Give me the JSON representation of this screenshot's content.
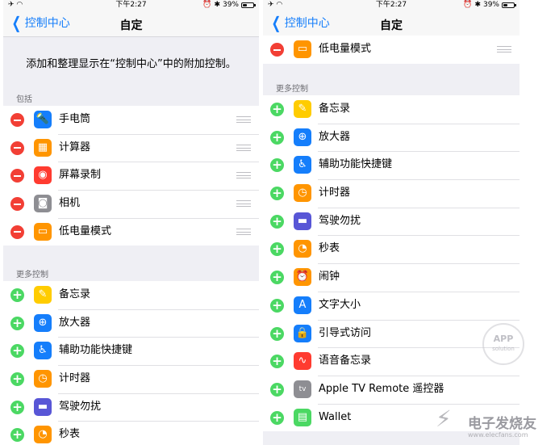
{
  "left": {
    "status": {
      "time": "下午2:27",
      "battery": "39%",
      "battery_level": 0.39
    },
    "nav": {
      "back": "控制中心",
      "title": "自定"
    },
    "description": "添加和整理显示在“控制中心”中的附加控制。",
    "included_header": "包括",
    "included": [
      {
        "label": "手电筒",
        "icon": "flashlight-icon",
        "color": "#157efb"
      },
      {
        "label": "计算器",
        "icon": "calculator-icon",
        "color": "#ff9500"
      },
      {
        "label": "屏幕录制",
        "icon": "screen-record-icon",
        "color": "#ff3b30"
      },
      {
        "label": "相机",
        "icon": "camera-icon",
        "color": "#8e8e93"
      },
      {
        "label": "低电量模式",
        "icon": "low-power-icon",
        "color": "#ff9500"
      }
    ],
    "more_header": "更多控制",
    "more": [
      {
        "label": "备忘录",
        "icon": "notes-icon",
        "color": "#ffcc00"
      },
      {
        "label": "放大器",
        "icon": "magnifier-icon",
        "color": "#157efb"
      },
      {
        "label": "辅助功能快捷键",
        "icon": "accessibility-icon",
        "color": "#157efb"
      },
      {
        "label": "计时器",
        "icon": "timer-icon",
        "color": "#ff9500"
      },
      {
        "label": "驾驶勿扰",
        "icon": "car-icon",
        "color": "#5856d6"
      },
      {
        "label": "秒表",
        "icon": "stopwatch-icon",
        "color": "#ff9500"
      }
    ]
  },
  "right": {
    "status": {
      "time": "下午2:27",
      "battery": "39%",
      "battery_level": 0.39
    },
    "nav": {
      "back": "控制中心",
      "title": "自定"
    },
    "included": [
      {
        "label": "低电量模式",
        "icon": "low-power-icon",
        "color": "#ff9500"
      }
    ],
    "more_header": "更多控制",
    "more": [
      {
        "label": "备忘录",
        "icon": "notes-icon",
        "color": "#ffcc00"
      },
      {
        "label": "放大器",
        "icon": "magnifier-icon",
        "color": "#157efb"
      },
      {
        "label": "辅助功能快捷键",
        "icon": "accessibility-icon",
        "color": "#157efb"
      },
      {
        "label": "计时器",
        "icon": "timer-icon",
        "color": "#ff9500"
      },
      {
        "label": "驾驶勿扰",
        "icon": "car-icon",
        "color": "#5856d6"
      },
      {
        "label": "秒表",
        "icon": "stopwatch-icon",
        "color": "#ff9500"
      },
      {
        "label": "闹钟",
        "icon": "alarm-icon",
        "color": "#ff9500"
      },
      {
        "label": "文字大小",
        "icon": "text-size-icon",
        "color": "#157efb"
      },
      {
        "label": "引导式访问",
        "icon": "guided-access-icon",
        "color": "#157efb"
      },
      {
        "label": "语音备忘录",
        "icon": "voice-memo-icon",
        "color": "#ff3b30"
      },
      {
        "label": "Apple TV Remote 遥控器",
        "icon": "apple-tv-icon",
        "color": "#8e8e93"
      },
      {
        "label": "Wallet",
        "icon": "wallet-icon",
        "color": "#4bd863"
      }
    ]
  },
  "watermarks": {
    "app_solution": {
      "line1": "APP",
      "line2": "solution"
    },
    "elecfans": {
      "name": "电子发烧友",
      "url": "www.elecfans.com"
    }
  }
}
